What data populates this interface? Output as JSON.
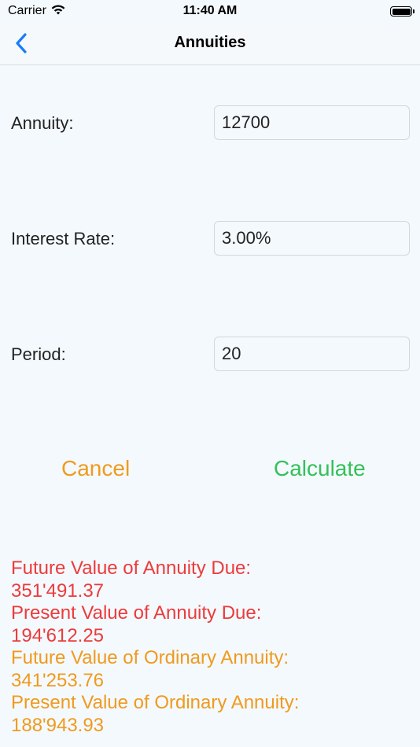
{
  "status_bar": {
    "carrier": "Carrier",
    "time": "11:40 AM"
  },
  "nav": {
    "title": "Annuities",
    "back_icon": "chevron-left-icon"
  },
  "form": {
    "annuity": {
      "label": "Annuity:",
      "value": "12700"
    },
    "interest_rate": {
      "label": "Interest Rate:",
      "value": "3.00%"
    },
    "period": {
      "label": "Period:",
      "value": "20"
    }
  },
  "actions": {
    "cancel_label": "Cancel",
    "calculate_label": "Calculate"
  },
  "results": {
    "fv_due_label": "Future Value of Annuity Due:",
    "fv_due_value": "351'491.37",
    "pv_due_label": "Present Value of Annuity Due:",
    "pv_due_value": "194'612.25",
    "fv_ordinary_label": "Future Value of Ordinary Annuity:",
    "fv_ordinary_value": "341'253.76",
    "pv_ordinary_label": "Present Value of Ordinary Annuity:",
    "pv_ordinary_value": "188'943.93"
  },
  "colors": {
    "accent_blue": "#1a7cf5",
    "cancel_orange": "#f09a1e",
    "calculate_green": "#34c05a",
    "result_red": "#ec3b3b",
    "result_orange": "#f09a1e"
  }
}
